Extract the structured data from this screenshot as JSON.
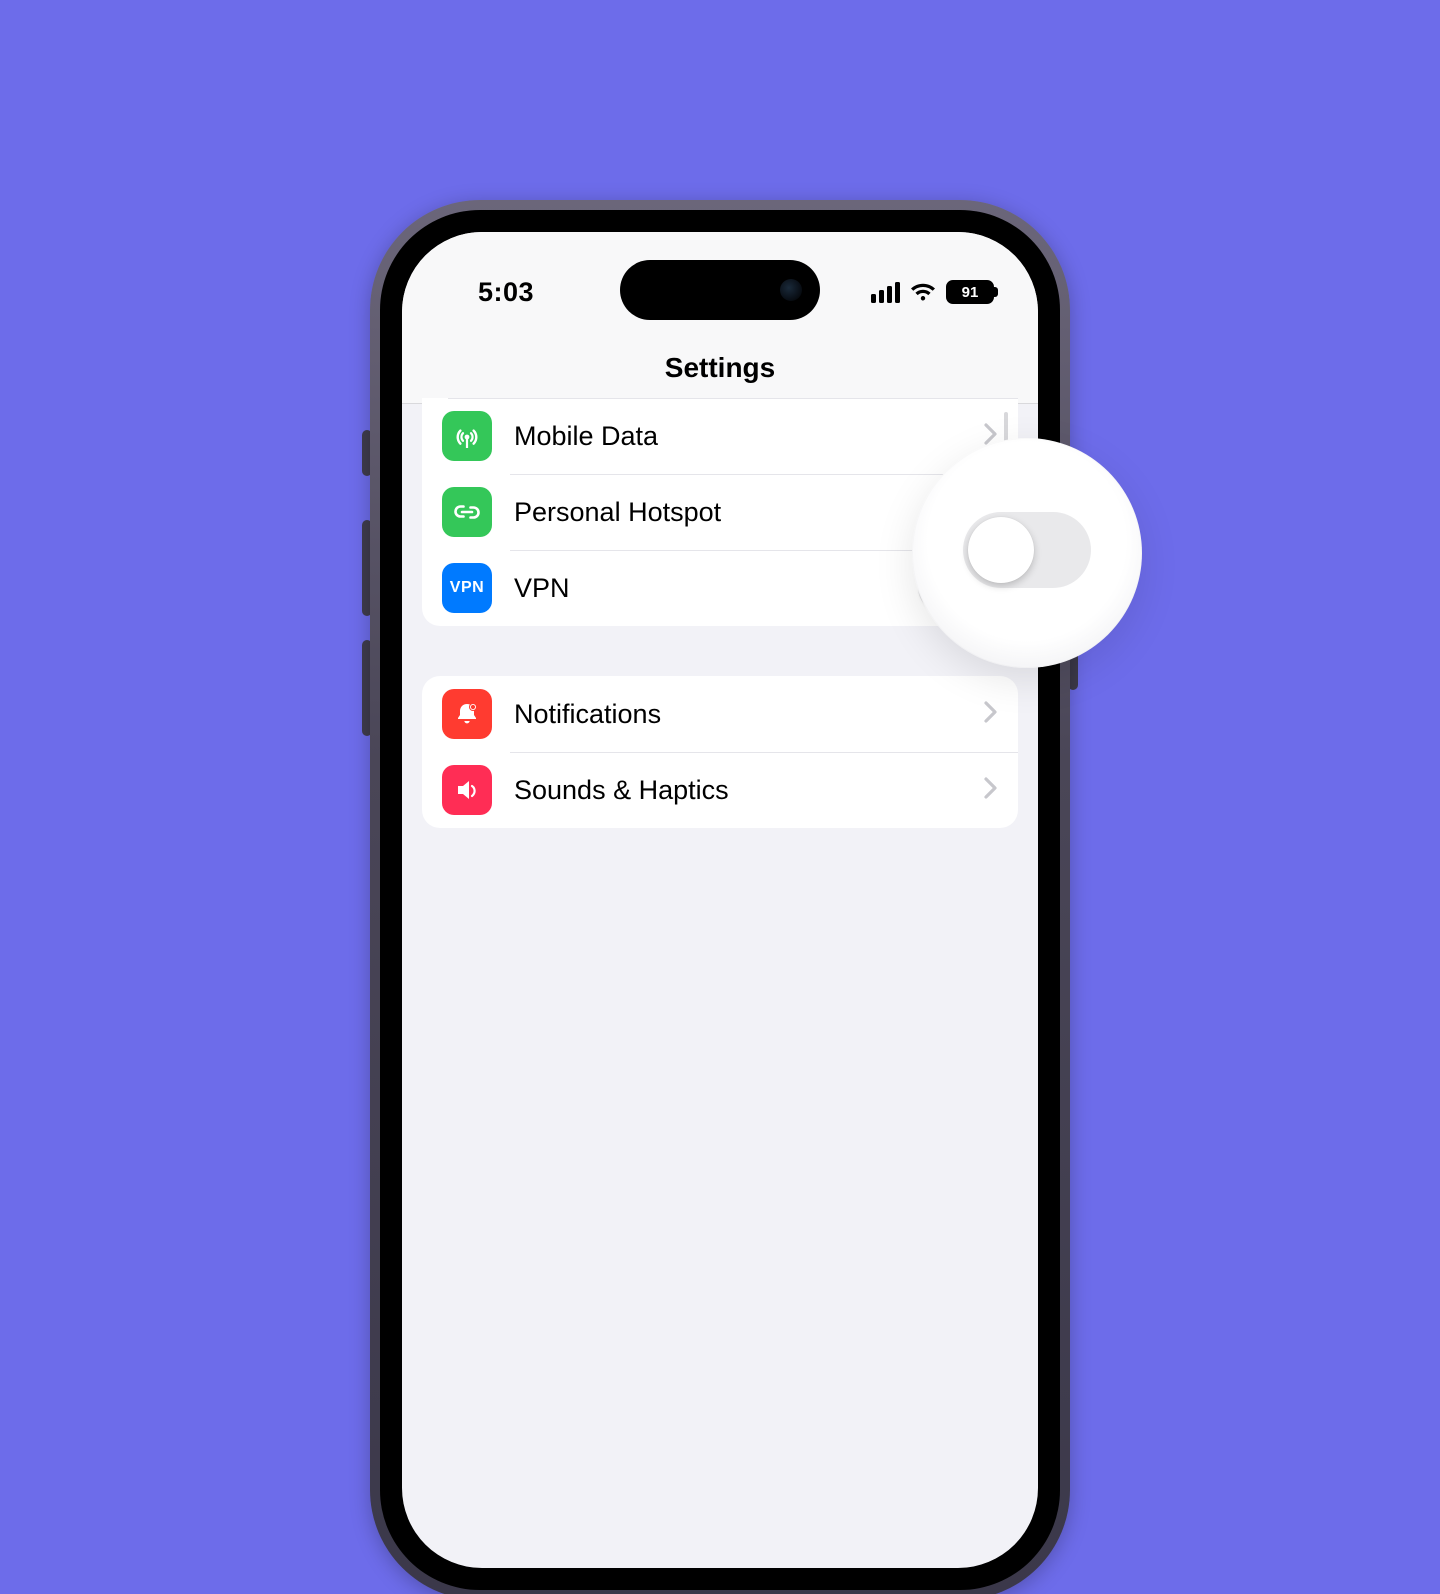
{
  "status": {
    "time": "5:03",
    "battery": "91"
  },
  "nav": {
    "title": "Settings"
  },
  "groups": [
    {
      "rows": [
        {
          "label": "Mobile Data"
        },
        {
          "label": "Personal Hotspot"
        },
        {
          "label": "VPN",
          "icon_text": "VPN"
        }
      ]
    },
    {
      "rows": [
        {
          "label": "Notifications"
        },
        {
          "label": "Sounds & Haptics"
        }
      ]
    }
  ]
}
